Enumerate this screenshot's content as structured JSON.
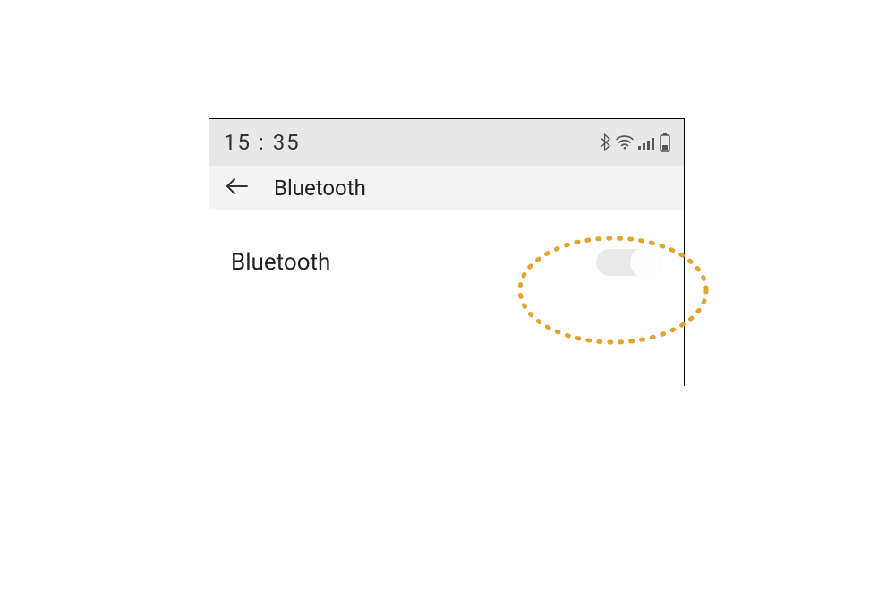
{
  "status_bar": {
    "time": "15 : 35"
  },
  "app_bar": {
    "title": "Bluetooth"
  },
  "settings": {
    "bluetooth": {
      "label": "Bluetooth",
      "enabled": true
    }
  }
}
